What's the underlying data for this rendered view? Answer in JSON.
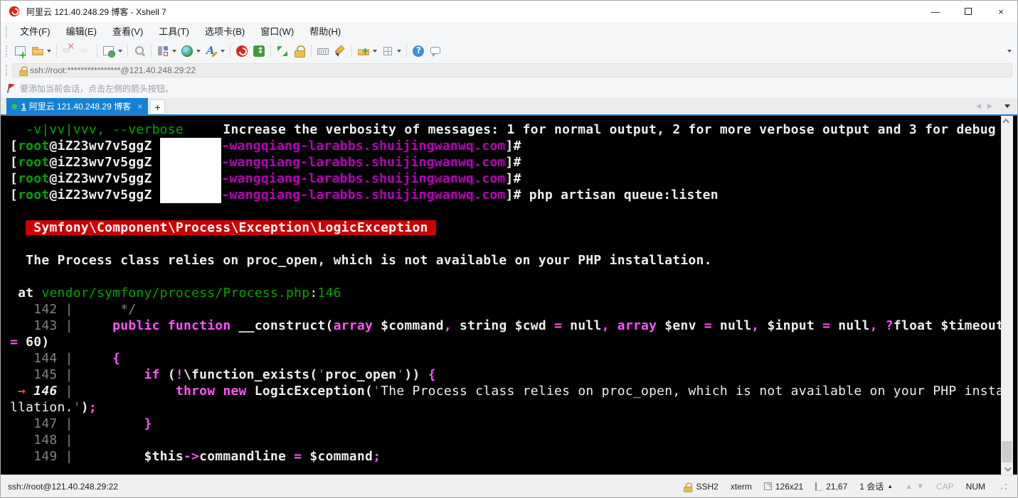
{
  "window": {
    "title": "阿里云 121.40.248.29 博客 - Xshell 7"
  },
  "window_controls": {
    "minimize": "—",
    "maximize": "",
    "close": "×"
  },
  "menu": {
    "items": [
      "文件(F)",
      "编辑(E)",
      "查看(V)",
      "工具(T)",
      "选项卡(B)",
      "窗口(W)",
      "帮助(H)"
    ]
  },
  "toolbar": {
    "buttons": [
      {
        "name": "new-session-icon",
        "caret": false,
        "sep": false
      },
      {
        "name": "open-folder-icon",
        "caret": true,
        "sep": true
      },
      {
        "name": "disconnect-icon",
        "caret": false,
        "sep": false,
        "disabled": true
      },
      {
        "name": "reconnect-icon",
        "caret": false,
        "sep": true,
        "disabled": true
      },
      {
        "name": "session-properties-icon",
        "caret": true,
        "sep": true
      },
      {
        "name": "find-icon",
        "caret": false,
        "sep": true
      },
      {
        "name": "compose-bar-icon",
        "caret": true,
        "sep": false
      },
      {
        "name": "encoding-globe-icon",
        "caret": true,
        "sep": false
      },
      {
        "name": "font-icon",
        "caret": true,
        "sep": true
      },
      {
        "name": "xshell-icon",
        "caret": false,
        "sep": false
      },
      {
        "name": "xftp-icon",
        "caret": false,
        "sep": true
      },
      {
        "name": "fullscreen-icon",
        "caret": false,
        "sep": false
      },
      {
        "name": "lock-screen-icon",
        "caret": false,
        "sep": true
      },
      {
        "name": "virtual-keyboard-icon",
        "caret": false,
        "sep": false
      },
      {
        "name": "highlight-pen-icon",
        "caret": false,
        "sep": true
      },
      {
        "name": "new-file-icon",
        "caret": true,
        "sep": false
      },
      {
        "name": "tile-windows-icon",
        "caret": true,
        "sep": true
      },
      {
        "name": "help-icon",
        "caret": false,
        "sep": false
      },
      {
        "name": "feedback-icon",
        "caret": false,
        "sep": false
      }
    ]
  },
  "address_bar": {
    "value": "ssh://root:****************@121.40.248.29:22"
  },
  "info_bar": {
    "text": "要添加当前会话，点击左侧的箭头按钮。"
  },
  "tabs": {
    "active_number": "1",
    "active_label": "阿里云 121.40.248.29 博客",
    "close_glyph": "×",
    "new_tab_glyph": "+",
    "prev_glyph": "◀",
    "next_glyph": "▶"
  },
  "colors": {
    "w": "#eeeeee",
    "g": "#00a400",
    "m": "#b800b8",
    "p": "#ff54ff",
    "gy": "#828282",
    "r": "#e5483d",
    "banner_bg": "#cc0000",
    "accent_blue": "#1681d2",
    "terminal_bg": "#000000"
  },
  "terminal": {
    "lines": [
      {
        "segments": [
          {
            "t": "  -v|vv|vvv, --verbose",
            "c": "g"
          },
          {
            "t": "     ",
            "c": "w"
          },
          {
            "t": "Increase the verbosity of messages: 1 for normal output, 2 for more verbose output and 3 for debug",
            "c": "w",
            "b": true
          }
        ]
      },
      {
        "segments": [
          {
            "t": "[",
            "c": "w",
            "b": true
          },
          {
            "t": "root",
            "c": "g",
            "b": true
          },
          {
            "t": "@iZ23wv7v5ggZ ",
            "c": "w",
            "b": true
          },
          {
            "redact": true
          },
          {
            "t": "-wangqiang-larabbs.shuijingwanwq.com",
            "c": "m",
            "b": true
          },
          {
            "t": "]#",
            "c": "w",
            "b": true
          }
        ]
      },
      {
        "segments": [
          {
            "t": "[",
            "c": "w",
            "b": true
          },
          {
            "t": "root",
            "c": "g",
            "b": true
          },
          {
            "t": "@iZ23wv7v5ggZ ",
            "c": "w",
            "b": true
          },
          {
            "redact": true
          },
          {
            "t": "-wangqiang-larabbs.shuijingwanwq.com",
            "c": "m",
            "b": true
          },
          {
            "t": "]#",
            "c": "w",
            "b": true
          }
        ]
      },
      {
        "segments": [
          {
            "t": "[",
            "c": "w",
            "b": true
          },
          {
            "t": "root",
            "c": "g",
            "b": true
          },
          {
            "t": "@iZ23wv7v5ggZ ",
            "c": "w",
            "b": true
          },
          {
            "redact": true
          },
          {
            "t": "-wangqiang-larabbs.shuijingwanwq.com",
            "c": "m",
            "b": true
          },
          {
            "t": "]#",
            "c": "w",
            "b": true
          }
        ]
      },
      {
        "segments": [
          {
            "t": "[",
            "c": "w",
            "b": true
          },
          {
            "t": "root",
            "c": "g",
            "b": true
          },
          {
            "t": "@iZ23wv7v5ggZ ",
            "c": "w",
            "b": true
          },
          {
            "redact": true
          },
          {
            "t": "-wangqiang-larabbs.shuijingwanwq.com",
            "c": "m",
            "b": true
          },
          {
            "t": "]#",
            "c": "w",
            "b": true
          },
          {
            "t": " php artisan queue:listen",
            "c": "w",
            "b": true
          }
        ]
      },
      {
        "segments": []
      },
      {
        "segments": [
          {
            "t": "  ",
            "c": "w"
          },
          {
            "t": " Symfony\\Component\\Process\\Exception\\LogicException ",
            "bg": "banner"
          }
        ]
      },
      {
        "segments": []
      },
      {
        "segments": [
          {
            "t": "  The Process class relies on proc_open, which is not available on your PHP installation.",
            "c": "w",
            "b": true
          }
        ]
      },
      {
        "segments": []
      },
      {
        "segments": [
          {
            "t": " at ",
            "c": "w",
            "b": true
          },
          {
            "t": "vendor/symfony/process/Process.php",
            "c": "g"
          },
          {
            "t": ":",
            "c": "w"
          },
          {
            "t": "146",
            "c": "g"
          }
        ]
      },
      {
        "segments": [
          {
            "t": "   142 | ",
            "c": "gy"
          },
          {
            "t": "     */",
            "c": "gy"
          }
        ]
      },
      {
        "segments": [
          {
            "t": "   143 | ",
            "c": "gy"
          },
          {
            "t": "    ",
            "c": "w"
          },
          {
            "t": "public function ",
            "c": "p",
            "b": true
          },
          {
            "t": "__construct(",
            "c": "w",
            "b": true
          },
          {
            "t": "array",
            "c": "p",
            "b": true
          },
          {
            "t": " $command",
            "c": "w",
            "b": true
          },
          {
            "t": ",",
            "c": "p",
            "b": true
          },
          {
            "t": " string $cwd ",
            "c": "w",
            "b": true
          },
          {
            "t": "=",
            "c": "p",
            "b": true
          },
          {
            "t": " null",
            "c": "w",
            "b": true
          },
          {
            "t": ",",
            "c": "p",
            "b": true
          },
          {
            "t": " ",
            "c": "w"
          },
          {
            "t": "array",
            "c": "p",
            "b": true
          },
          {
            "t": " $env ",
            "c": "w",
            "b": true
          },
          {
            "t": "=",
            "c": "p",
            "b": true
          },
          {
            "t": " null",
            "c": "w",
            "b": true
          },
          {
            "t": ",",
            "c": "p",
            "b": true
          },
          {
            "t": " $input ",
            "c": "w",
            "b": true
          },
          {
            "t": "=",
            "c": "p",
            "b": true
          },
          {
            "t": " null",
            "c": "w",
            "b": true
          },
          {
            "t": ",",
            "c": "p",
            "b": true
          },
          {
            "t": " ",
            "c": "w"
          },
          {
            "t": "?",
            "c": "p",
            "b": true
          },
          {
            "t": "float $timeout",
            "c": "w",
            "b": true
          }
        ]
      },
      {
        "segments": [
          {
            "t": "=",
            "c": "p",
            "b": true
          },
          {
            "t": " 60)",
            "c": "w",
            "b": true
          }
        ]
      },
      {
        "segments": [
          {
            "t": "   144 | ",
            "c": "gy"
          },
          {
            "t": "    ",
            "c": "w"
          },
          {
            "t": "{",
            "c": "p",
            "b": true
          }
        ]
      },
      {
        "segments": [
          {
            "t": "   145 | ",
            "c": "gy"
          },
          {
            "t": "        ",
            "c": "w"
          },
          {
            "t": "if ",
            "c": "p",
            "b": true
          },
          {
            "t": "(",
            "c": "w",
            "b": true
          },
          {
            "t": "!",
            "c": "p",
            "b": true
          },
          {
            "t": "\\function_exists(",
            "c": "w",
            "b": true
          },
          {
            "t": "'",
            "c": "gy"
          },
          {
            "t": "proc_open",
            "c": "w",
            "b": true
          },
          {
            "t": "'",
            "c": "gy"
          },
          {
            "t": ")) ",
            "c": "w",
            "b": true
          },
          {
            "t": "{",
            "c": "p",
            "b": true
          }
        ]
      },
      {
        "segments": [
          {
            "t": " ",
            "c": "w"
          },
          {
            "t": "→",
            "c": "r",
            "b": true
          },
          {
            "t": " ",
            "c": "w"
          },
          {
            "t": "146",
            "c": "w",
            "b": true,
            "i": true
          },
          {
            "t": " | ",
            "c": "gy"
          },
          {
            "t": "            ",
            "c": "w"
          },
          {
            "t": "throw new ",
            "c": "p",
            "b": true
          },
          {
            "t": "LogicException(",
            "c": "w",
            "b": true
          },
          {
            "t": "'",
            "c": "gy"
          },
          {
            "t": "The Process class relies on proc_open, which is not available on your PHP insta",
            "c": "w"
          }
        ]
      },
      {
        "segments": [
          {
            "t": "llation.",
            "c": "w"
          },
          {
            "t": "'",
            "c": "gy"
          },
          {
            "t": ")",
            "c": "w",
            "b": true
          },
          {
            "t": ";",
            "c": "p",
            "b": true
          }
        ]
      },
      {
        "segments": [
          {
            "t": "   147 | ",
            "c": "gy"
          },
          {
            "t": "        ",
            "c": "w"
          },
          {
            "t": "}",
            "c": "p",
            "b": true
          }
        ]
      },
      {
        "segments": [
          {
            "t": "   148 |",
            "c": "gy"
          }
        ]
      },
      {
        "segments": [
          {
            "t": "   149 | ",
            "c": "gy"
          },
          {
            "t": "        ",
            "c": "w"
          },
          {
            "t": "$this",
            "c": "w",
            "b": true
          },
          {
            "t": "->",
            "c": "p",
            "b": true
          },
          {
            "t": "commandline ",
            "c": "w",
            "b": true
          },
          {
            "t": "=",
            "c": "p",
            "b": true
          },
          {
            "t": " $command",
            "c": "w",
            "b": true
          },
          {
            "t": ";",
            "c": "p",
            "b": true
          }
        ]
      }
    ]
  },
  "status_bar": {
    "url": "ssh://root@121.40.248.29:22",
    "protocol": "SSH2",
    "terminal_type": "xterm",
    "screen_size": "126x21",
    "cursor_position": "21,67",
    "sessions": "1 会话",
    "caps_indicator": "CAP",
    "num_indicator": "NUM",
    "arrow_up": "▲",
    "arrow_down": "▼",
    "sessions_caret": "▲"
  }
}
